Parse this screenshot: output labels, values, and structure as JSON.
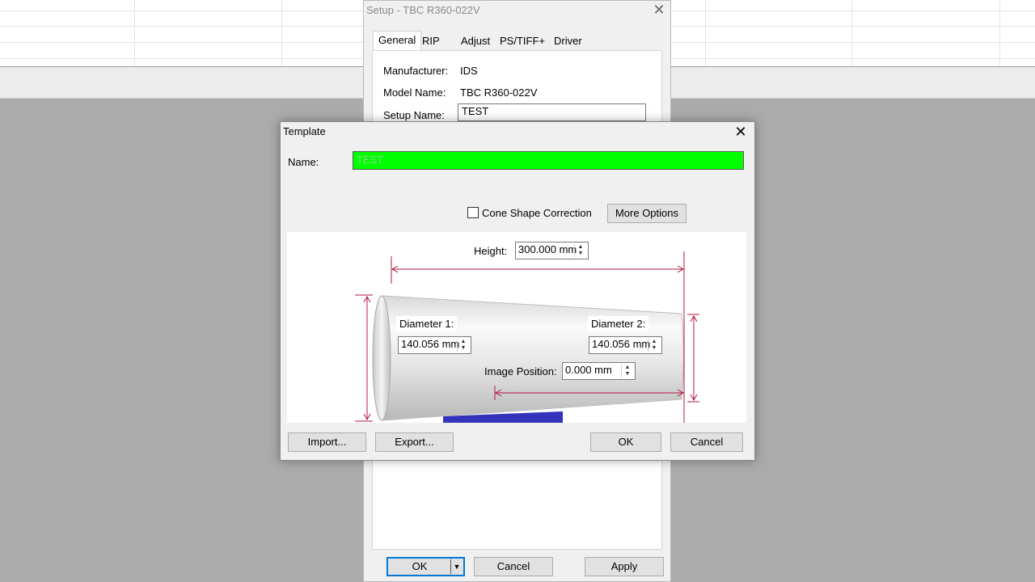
{
  "setup_dialog": {
    "title": "Setup - TBC R360-022V",
    "tabs": [
      "General",
      "RIP",
      "Adjust",
      "PS/TIFF+",
      "Driver"
    ],
    "manufacturer_label": "Manufacturer:",
    "manufacturer_value": "IDS",
    "model_label": "Model Name:",
    "model_value": "TBC R360-022V",
    "setup_name_label": "Setup Name:",
    "setup_name_value": "TEST",
    "ok_label": "OK",
    "cancel_label": "Cancel",
    "apply_label": "Apply"
  },
  "template_dialog": {
    "title": "Template",
    "name_label": "Name:",
    "name_value": "TEST",
    "cone_checkbox_label": "Cone Shape Correction",
    "cone_checkbox_checked": false,
    "more_options_label": "More Options",
    "height_label": "Height:",
    "height_value": "300.000 mm",
    "diameter1_label": "Diameter 1:",
    "diameter1_value": "140.056 mm",
    "diameter2_label": "Diameter 2:",
    "diameter2_value": "140.056 mm",
    "image_position_label": "Image Position:",
    "image_position_value": "0.000 mm",
    "import_label": "Import...",
    "export_label": "Export...",
    "ok_label": "OK",
    "cancel_label": "Cancel"
  },
  "colors": {
    "name_highlight": "#00ff00",
    "dimension_lines": "#b0173e",
    "cone_base": "#3333bb"
  },
  "icons": {
    "close": "close-icon",
    "spin": "spin-arrows-icon",
    "dropdown": "dropdown-arrow-icon"
  }
}
